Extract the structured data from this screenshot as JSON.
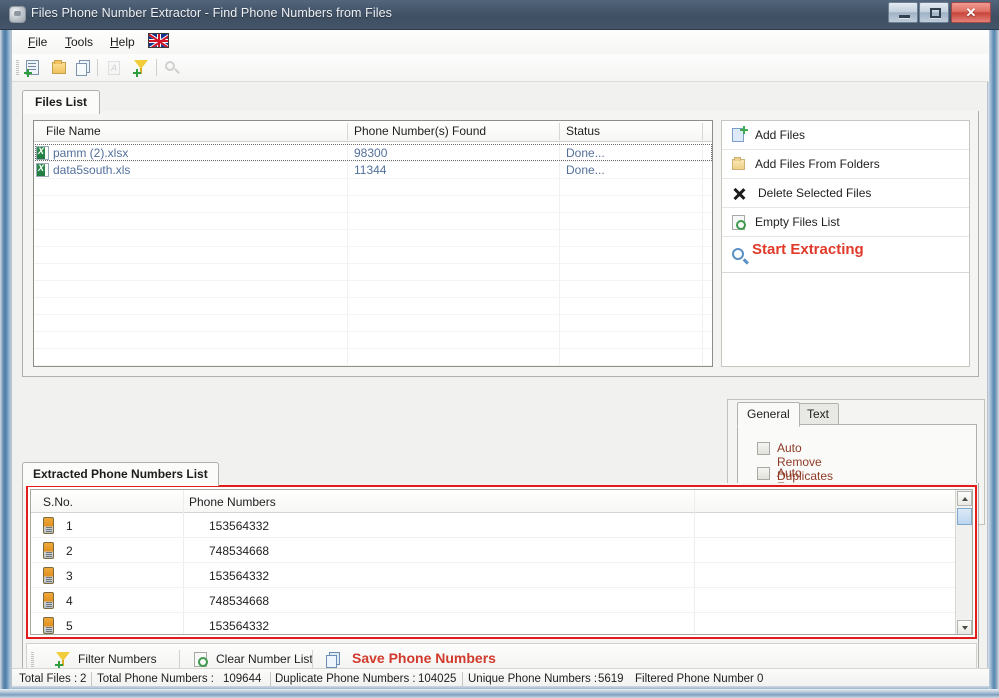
{
  "window": {
    "title": "Files Phone Number Extractor - Find Phone Numbers from Files",
    "app_icon": "app-icon",
    "minimize": "–",
    "maximize": "□",
    "close": "✕"
  },
  "menu": {
    "items": [
      {
        "label": "File",
        "mnemonic": "F"
      },
      {
        "label": "Tools",
        "mnemonic": "T"
      },
      {
        "label": "Help",
        "mnemonic": "H"
      }
    ],
    "flag": "uk-flag-icon"
  },
  "toolbar": {
    "icons": [
      {
        "name": "add-files-icon",
        "enabled": true
      },
      {
        "name": "add-files-from-folders-icon",
        "enabled": true
      },
      {
        "name": "copy-files-icon",
        "enabled": true
      },
      {
        "name": "text-extract-icon",
        "enabled": false
      },
      {
        "name": "filter-numbers-icon",
        "enabled": true
      },
      {
        "name": "search-icon",
        "enabled": false
      }
    ]
  },
  "files_tab": {
    "label": "Files List",
    "columns": [
      "File Name",
      "Phone Number(s) Found",
      "Status"
    ],
    "rows": [
      {
        "file": "pamm (2).xlsx",
        "found": "98300",
        "status": "Done...",
        "focused": true
      },
      {
        "file": "data5south.xls",
        "found": "11344",
        "status": "Done...",
        "focused": false
      }
    ]
  },
  "actions": [
    {
      "label": "Add Files",
      "icon": "add-files-icon"
    },
    {
      "label": "Add Files From Folders",
      "icon": "folder-icon"
    },
    {
      "label": "Delete Selected Files",
      "icon": "delete-x-icon"
    },
    {
      "label": "Empty Files List",
      "icon": "empty-list-icon"
    },
    {
      "label": "Start Extracting",
      "icon": "search-icon"
    }
  ],
  "options": {
    "tabs": [
      {
        "label": "General",
        "active": true
      },
      {
        "label": "Text",
        "active": false
      }
    ],
    "checkboxes": [
      {
        "label": "Auto Remove Duplicates",
        "checked": false
      },
      {
        "label": "Auto Extract Number",
        "checked": false
      }
    ]
  },
  "extracted_tab": {
    "label": "Extracted Phone Numbers List",
    "columns": [
      "S.No.",
      "Phone Numbers",
      ""
    ],
    "rows": [
      {
        "sno": "1",
        "number": "153564332"
      },
      {
        "sno": "2",
        "number": "748534668"
      },
      {
        "sno": "3",
        "number": "153564332"
      },
      {
        "sno": "4",
        "number": "748534668"
      },
      {
        "sno": "5",
        "number": "153564332"
      }
    ]
  },
  "bottom_bar": {
    "filter": "Filter Numbers",
    "clear": "Clear Number List",
    "save": "Save Phone Numbers"
  },
  "status_bar": {
    "total_files_label": "Total Files :",
    "total_files_value": "2",
    "total_numbers_label": "Total Phone Numbers :",
    "total_numbers_value": "109644",
    "duplicate_label": "Duplicate Phone Numbers :",
    "duplicate_value": "104025",
    "unique_label": "Unique Phone Numbers :",
    "unique_value": "5619",
    "filtered_label": "Filtered Phone Number",
    "filtered_value": "0"
  },
  "colors": {
    "titlebar": "#435365",
    "accent_red": "#e03a2a",
    "link_blue": "#53709b",
    "option_label": "#8f3a26",
    "highlight_border": "#e21b1b"
  }
}
